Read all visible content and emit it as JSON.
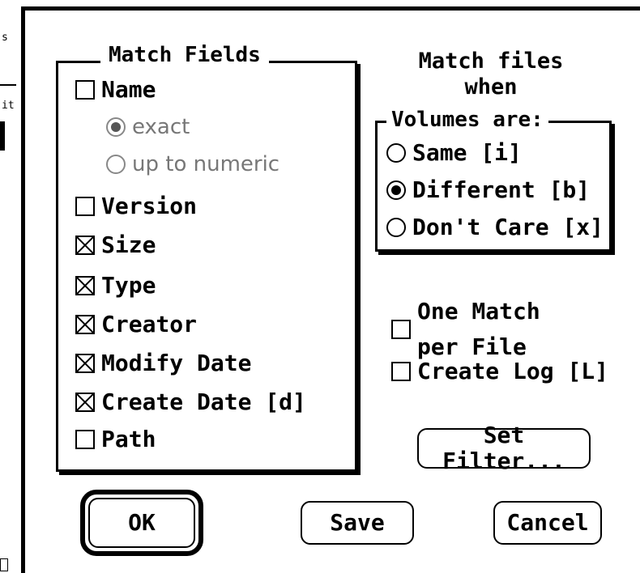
{
  "background_window": {
    "fragments": [
      "s",
      "it"
    ]
  },
  "match_fields": {
    "title": "Match Fields",
    "items": [
      {
        "label": "Name",
        "checked": false
      },
      {
        "label": "Version",
        "checked": false
      },
      {
        "label": "Size",
        "checked": true
      },
      {
        "label": "Type",
        "checked": true
      },
      {
        "label": "Creator",
        "checked": true
      },
      {
        "label": "Modify Date",
        "checked": true
      },
      {
        "label": "Create Date [d]",
        "checked": true
      },
      {
        "label": "Path",
        "checked": false
      }
    ],
    "name_options": [
      {
        "label": "exact",
        "selected": true,
        "enabled": false
      },
      {
        "label": "up to numeric",
        "selected": false,
        "enabled": false
      }
    ]
  },
  "match_when": {
    "heading_line1": "Match files",
    "heading_line2": "when",
    "group_title": "Volumes are:",
    "options": [
      {
        "label": "Same [i]",
        "selected": false
      },
      {
        "label": "Different [b]",
        "selected": true
      },
      {
        "label": "Don't Care [x]",
        "selected": false
      }
    ]
  },
  "one_match": {
    "line1": "One Match",
    "line2": "per File",
    "checked": false
  },
  "create_log": {
    "label": "Create Log [L]",
    "checked": false
  },
  "buttons": {
    "set_filter": "Set Filter...",
    "ok": "OK",
    "save": "Save",
    "cancel": "Cancel"
  }
}
